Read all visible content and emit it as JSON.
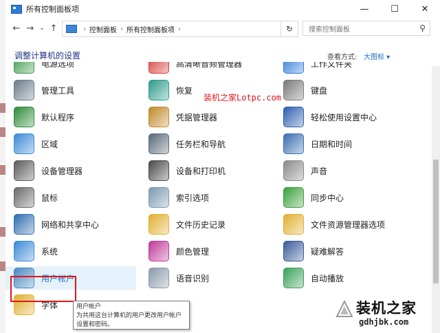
{
  "window": {
    "title": "所有控制面板项"
  },
  "addressbar": {
    "crumb1": "控制面板",
    "crumb2": "所有控制面板项",
    "search_placeholder": "搜索控制面板"
  },
  "header": {
    "title": "调整计算机的设置",
    "view_label": "查看方式:",
    "view_value": "大图标 ▾"
  },
  "items": [
    {
      "label": "电源选项",
      "icon": "power-icon",
      "color": "#3a9a4a"
    },
    {
      "label": "高清晰音频管理器",
      "icon": "audio-icon",
      "color": "#d63a3a"
    },
    {
      "label": "工作文件夹",
      "icon": "work-folders-icon",
      "color": "#2f7bd6"
    },
    {
      "label": "管理工具",
      "icon": "admin-tools-icon",
      "color": "#6a7d8a"
    },
    {
      "label": "恢复",
      "icon": "recovery-icon",
      "color": "#2e9c8a"
    },
    {
      "label": "键盘",
      "icon": "keyboard-icon",
      "color": "#7a7a7a"
    },
    {
      "label": "默认程序",
      "icon": "default-programs-icon",
      "color": "#2e8b3a"
    },
    {
      "label": "凭据管理器",
      "icon": "credential-icon",
      "color": "#c08a2a"
    },
    {
      "label": "轻松使用设置中心",
      "icon": "ease-of-access-icon",
      "color": "#2f5fb0"
    },
    {
      "label": "区域",
      "icon": "region-icon",
      "color": "#3a8ad6"
    },
    {
      "label": "任务栏和导航",
      "icon": "taskbar-icon",
      "color": "#5a6a7a"
    },
    {
      "label": "日期和时间",
      "icon": "clock-icon",
      "color": "#3a6fb0"
    },
    {
      "label": "设备管理器",
      "icon": "device-manager-icon",
      "color": "#5a5a5a"
    },
    {
      "label": "设备和打印机",
      "icon": "printer-icon",
      "color": "#4a4a4a"
    },
    {
      "label": "声音",
      "icon": "speaker-icon",
      "color": "#8a8a8a"
    },
    {
      "label": "鼠标",
      "icon": "mouse-icon",
      "color": "#6a6a6a"
    },
    {
      "label": "索引选项",
      "icon": "indexing-icon",
      "color": "#7a9ab0"
    },
    {
      "label": "同步中心",
      "icon": "sync-icon",
      "color": "#3aa03a"
    },
    {
      "label": "网络和共享中心",
      "icon": "network-icon",
      "color": "#2f6fb0"
    },
    {
      "label": "文件历史记录",
      "icon": "file-history-icon",
      "color": "#e0b030"
    },
    {
      "label": "文件资源管理器选项",
      "icon": "folder-options-icon",
      "color": "#e0b030"
    },
    {
      "label": "系统",
      "icon": "system-icon",
      "color": "#3a8ad6"
    },
    {
      "label": "颜色管理",
      "icon": "color-management-icon",
      "color": "#c03a9a"
    },
    {
      "label": "疑难解答",
      "icon": "troubleshoot-icon",
      "color": "#3a5a9a"
    },
    {
      "label": "用户帐户",
      "icon": "user-accounts-icon",
      "color": "#4a8ac0"
    },
    {
      "label": "语音识别",
      "icon": "microphone-icon",
      "color": "#8a9aaa"
    },
    {
      "label": "自动播放",
      "icon": "autoplay-icon",
      "color": "#3aa05a"
    },
    {
      "label": "字体",
      "icon": "fonts-icon",
      "color": "#e0b030"
    }
  ],
  "tooltip": {
    "title": "用户帐户",
    "body": "为共用这台计算机的用户更改用户帐户设置和密码。"
  },
  "watermark": {
    "inline": "装机之家Lotpc.com",
    "brand": "装机之家",
    "url": "gdhjbk.com"
  }
}
